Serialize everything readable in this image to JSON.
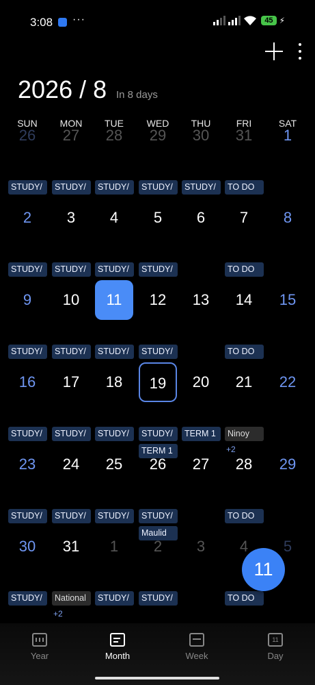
{
  "status": {
    "time": "3:08",
    "dots": "···",
    "battery": "45"
  },
  "header": {
    "title": "2026 / 8",
    "subtitle": "In 8 days"
  },
  "weekdays": [
    "SUN",
    "MON",
    "TUE",
    "WED",
    "THU",
    "FRI",
    "SAT"
  ],
  "weeks": [
    {
      "days": [
        {
          "n": "26",
          "other": true,
          "events": [
            "STUDY/"
          ]
        },
        {
          "n": "27",
          "other": true,
          "events": [
            "STUDY/"
          ]
        },
        {
          "n": "28",
          "other": true,
          "events": [
            "STUDY/"
          ]
        },
        {
          "n": "29",
          "other": true,
          "events": [
            "STUDY/"
          ]
        },
        {
          "n": "30",
          "other": true,
          "events": [
            "STUDY/"
          ]
        },
        {
          "n": "31",
          "other": true,
          "events": [
            "TO DO"
          ]
        },
        {
          "n": "1",
          "events": []
        }
      ]
    },
    {
      "days": [
        {
          "n": "2",
          "events": [
            "STUDY/"
          ]
        },
        {
          "n": "3",
          "events": [
            "STUDY/"
          ]
        },
        {
          "n": "4",
          "events": [
            "STUDY/"
          ]
        },
        {
          "n": "5",
          "events": [
            "STUDY/"
          ]
        },
        {
          "n": "6",
          "events": []
        },
        {
          "n": "7",
          "events": [
            "TO DO"
          ]
        },
        {
          "n": "8",
          "events": []
        }
      ]
    },
    {
      "days": [
        {
          "n": "9",
          "events": [
            "STUDY/"
          ]
        },
        {
          "n": "10",
          "events": [
            "STUDY/"
          ]
        },
        {
          "n": "11",
          "today": true,
          "events": [
            "STUDY/"
          ]
        },
        {
          "n": "12",
          "events": [
            "STUDY/"
          ]
        },
        {
          "n": "13",
          "events": []
        },
        {
          "n": "14",
          "events": [
            "TO DO"
          ]
        },
        {
          "n": "15",
          "events": []
        }
      ]
    },
    {
      "days": [
        {
          "n": "16",
          "events": [
            "STUDY/"
          ]
        },
        {
          "n": "17",
          "events": [
            "STUDY/"
          ]
        },
        {
          "n": "18",
          "events": [
            "STUDY/"
          ]
        },
        {
          "n": "19",
          "selected": true,
          "events": [
            "STUDY/",
            "TERM 1"
          ]
        },
        {
          "n": "20",
          "events": [
            "TERM 1"
          ]
        },
        {
          "n": "21",
          "events": [
            "Ninoy"
          ],
          "gray": true,
          "more": "+2"
        },
        {
          "n": "22",
          "events": []
        }
      ]
    },
    {
      "days": [
        {
          "n": "23",
          "events": [
            "STUDY/"
          ]
        },
        {
          "n": "24",
          "events": [
            "STUDY/"
          ]
        },
        {
          "n": "25",
          "events": [
            "STUDY/"
          ]
        },
        {
          "n": "26",
          "events": [
            "STUDY/",
            "Maulid"
          ]
        },
        {
          "n": "27",
          "events": []
        },
        {
          "n": "28",
          "events": [
            "TO DO"
          ]
        },
        {
          "n": "29",
          "events": []
        }
      ]
    },
    {
      "days": [
        {
          "n": "30",
          "events": [
            "STUDY/"
          ]
        },
        {
          "n": "31",
          "events": [
            "National"
          ],
          "gray": true,
          "more": "+2"
        },
        {
          "n": "1",
          "other": true,
          "events": [
            "STUDY/"
          ]
        },
        {
          "n": "2",
          "other": true,
          "events": [
            "STUDY/"
          ]
        },
        {
          "n": "3",
          "other": true,
          "events": []
        },
        {
          "n": "4",
          "other": true,
          "events": [
            "TO DO"
          ]
        },
        {
          "n": "5",
          "other": true,
          "events": []
        }
      ]
    }
  ],
  "fab": {
    "label": "11"
  },
  "nav": [
    {
      "label": "Year",
      "icon": "year-grid-icon"
    },
    {
      "label": "Month",
      "icon": "month-icon",
      "active": true
    },
    {
      "label": "Week",
      "icon": "week-icon"
    },
    {
      "label": "Day",
      "icon": "day-icon",
      "icon_text": "11"
    }
  ]
}
